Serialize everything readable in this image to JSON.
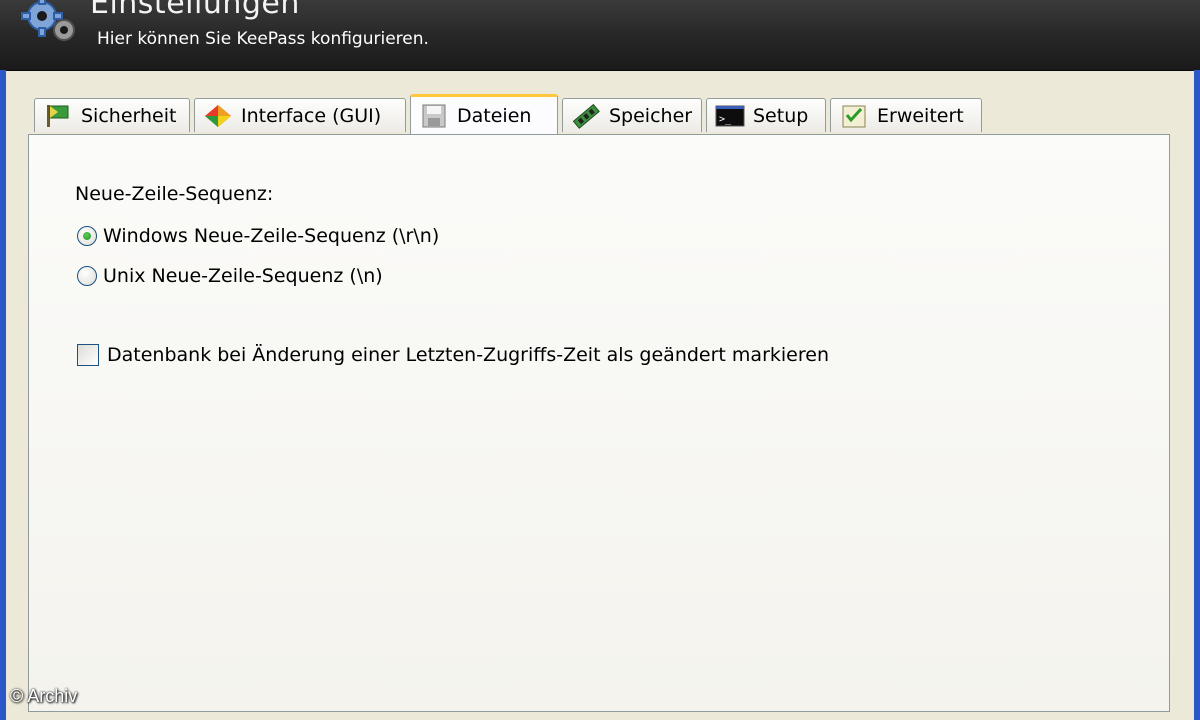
{
  "header": {
    "title": "Einstellungen",
    "subtitle": "Hier können Sie KeePass konfigurieren.",
    "icon": "gear-icon"
  },
  "tabs": [
    {
      "label": "Sicherheit",
      "icon": "flag-icon",
      "active": false
    },
    {
      "label": "Interface (GUI)",
      "icon": "colorful-diamond-icon",
      "active": false
    },
    {
      "label": "Dateien",
      "icon": "floppy-disk-icon",
      "active": true
    },
    {
      "label": "Speicher",
      "icon": "memory-chip-icon",
      "active": false
    },
    {
      "label": "Setup",
      "icon": "console-icon",
      "active": false
    },
    {
      "label": "Erweitert",
      "icon": "checklist-icon",
      "active": false
    }
  ],
  "files_page": {
    "newline_label": "Neue-Zeile-Sequenz:",
    "radio_windows": "Windows Neue-Zeile-Sequenz (\\r\\n)",
    "radio_unix": "Unix Neue-Zeile-Sequenz (\\n)",
    "selected_newline": "windows",
    "checkbox_mark_modified": "Datenbank bei Änderung einer Letzten-Zugriffs-Zeit als geändert markieren",
    "checkbox_checked": false
  },
  "watermark": "© Archiv",
  "colors": {
    "banner": "#262626",
    "window_frame": "#2c57c9",
    "active_tab_highlight": "#ffc83c",
    "radio_dot": "#219521"
  }
}
